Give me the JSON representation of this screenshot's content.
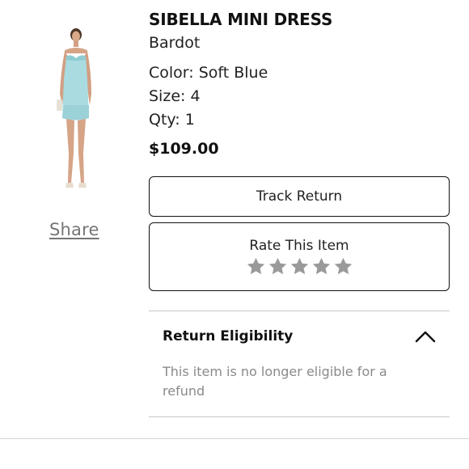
{
  "product": {
    "name": "SIBELLA MINI DRESS",
    "brand": "Bardot",
    "color": "Color: Soft Blue",
    "size": "Size: 4",
    "qty": "Qty: 1",
    "price": "$109.00",
    "image_icon": "dress-photo"
  },
  "actions": {
    "share_label": "Share",
    "track_return_label": "Track Return",
    "rate_label": "Rate This Item",
    "rating": {
      "value": 0,
      "max": 5
    }
  },
  "return_eligibility": {
    "title": "Return Eligibility",
    "expanded": true,
    "message": "This item is no longer eligible for a refund"
  },
  "colors": {
    "text": "#111111",
    "muted": "#8a8a8a",
    "share": "#757575",
    "star_empty": "#9a9a9a",
    "dress": "#a9dbe0"
  }
}
